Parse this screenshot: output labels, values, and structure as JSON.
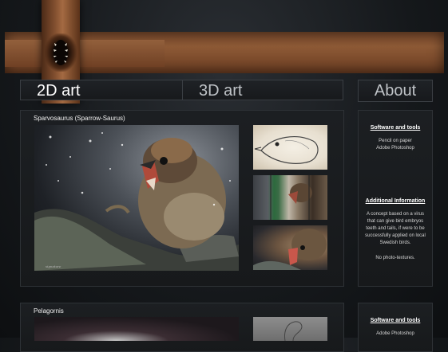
{
  "nav": {
    "tab_2d": "2D art",
    "tab_3d": "3D art",
    "tab_about": "About"
  },
  "projects": [
    {
      "title": "Sparvosaurus (Sparrow-Saurus)",
      "info": {
        "tools_heading": "Software and tools",
        "tools": [
          "Pencil on paper",
          "Adobe Photoshop"
        ],
        "additional_heading": "Additional Information",
        "additional_text": "A concept based on a virus that can give bird embryos teeth and tails, if were to be successfully applied on local Swedish birds.",
        "note": "No photo-textures."
      }
    },
    {
      "title": "Pelagornis",
      "info": {
        "tools_heading": "Software and tools",
        "tools": [
          "Adobe Photoshop"
        ]
      }
    }
  ],
  "colors": {
    "banner": "#8e5a36",
    "panel": "#1c1f22",
    "background": "#15181b"
  }
}
